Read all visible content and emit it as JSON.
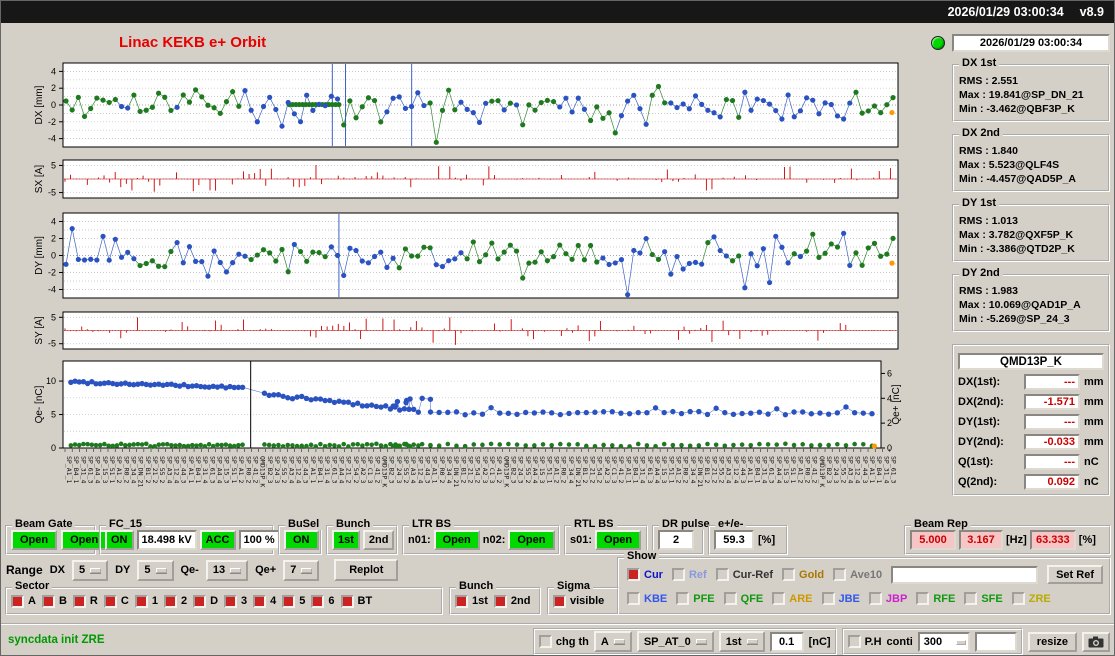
{
  "titlebar": {
    "datetime": "2026/01/29 03:00:34",
    "version": "v8.9"
  },
  "header": {
    "title": "Linac KEKB e+ Orbit",
    "timestamp": "2026/01/29 03:00:34"
  },
  "plots": {
    "dx": {
      "label": "DX [mm]",
      "ticks": [
        "4",
        "2",
        "0",
        "-2",
        "-4"
      ]
    },
    "sx": {
      "label": "SX [A]",
      "ticks": [
        "5",
        "-5"
      ]
    },
    "dy": {
      "label": "DY [mm]",
      "ticks": [
        "4",
        "2",
        "0",
        "-2",
        "-4"
      ]
    },
    "sy": {
      "label": "SY [A]",
      "ticks": [
        "5",
        "-5"
      ]
    },
    "q": {
      "label": "Qe- [nC]",
      "ticks": [
        "10",
        "5",
        "0"
      ],
      "right_label": "Qe+ [nC]",
      "right_ticks": [
        "6",
        "4",
        "2",
        "0"
      ]
    },
    "x_sample_labels": [
      "SP_A1_1",
      "SP_A1_2",
      "SP_A2_3",
      "SP_A3_4",
      "SP_A4_4",
      "SP_B1_2",
      "SP_B2_3",
      "SP_B4_1",
      "SP_R0_2",
      "SP_C1_3",
      "SP_12_4",
      "SP_15_3",
      "SP_21_2",
      "SP_24_3",
      "SP_31_4",
      "SP_34_4",
      "SP_41_2",
      "SP_44_3",
      "SP_51_1",
      "SP_54_2",
      "SP_55_2",
      "SP_61_3",
      "SP_DN_21",
      "QMD13P_K"
    ]
  },
  "chart_data": [
    {
      "type": "scatter",
      "name": "DX orbit",
      "ylabel": "DX [mm]",
      "ylim": [
        -5,
        5
      ],
      "series": [
        {
          "name": "1st bunch",
          "color": "#1f7a1f"
        },
        {
          "name": "2nd bunch",
          "color": "#2a52c0"
        }
      ],
      "summary": "orbit deviation per BPM, mostly within +/-3 mm, RMS 2.551 (1st) / 1.840 (2nd)"
    },
    {
      "type": "bar",
      "name": "SX steering",
      "ylabel": "SX [A]",
      "ylim": [
        -7,
        7
      ],
      "color": "#cc0000",
      "summary": "small bipolar steering currents, larger burst near 30% of axis"
    },
    {
      "type": "scatter",
      "name": "DY orbit",
      "ylabel": "DY [mm]",
      "ylim": [
        -5,
        5
      ],
      "series": [
        {
          "name": "1st bunch",
          "color": "#1f7a1f"
        },
        {
          "name": "2nd bunch",
          "color": "#2a52c0"
        }
      ],
      "summary": "RMS 1.013 (1st) / 1.983 (2nd), larger spread near right end"
    },
    {
      "type": "bar",
      "name": "SY steering",
      "ylabel": "SY [A]",
      "ylim": [
        -7,
        7
      ],
      "color": "#cc0000",
      "summary": "small bipolar steering currents with isolated tall spike near 47%"
    },
    {
      "type": "scatter",
      "name": "Charge",
      "ylabel": "Qe- [nC]",
      "ylim": [
        0,
        13
      ],
      "y2label": "Qe+ [nC]",
      "y2lim": [
        0,
        7
      ],
      "summary": "Qe- (blue) ~9.8 nC falling stepwise to ~5 nC along the linac; Qe+ (green) ~0.2 nC flat; black marker line near 23% of axis; orange marker at right end"
    }
  ],
  "stats": [
    {
      "title": "DX 1st",
      "rms": "RMS : 2.551",
      "max": "Max : 19.841@SP_DN_21",
      "min": "Min : -3.462@QBF3P_K"
    },
    {
      "title": "DX 2nd",
      "rms": "RMS : 1.840",
      "max": "Max : 5.523@QLF4S",
      "min": "Min : -4.457@QAD5P_A"
    },
    {
      "title": "DY 1st",
      "rms": "RMS : 1.013",
      "max": "Max : 3.782@QXF5P_K",
      "min": "Min : -3.386@QTD2P_K"
    },
    {
      "title": "DY 2nd",
      "rms": "RMS : 1.983",
      "max": "Max : 10.069@QAD1P_A",
      "min": "Min : -5.269@SP_24_3"
    }
  ],
  "monitor": {
    "name": "QMD13P_K",
    "rows": [
      {
        "label": "DX(1st):",
        "value": "---",
        "unit": "mm"
      },
      {
        "label": "DX(2nd):",
        "value": "-1.571",
        "unit": "mm"
      },
      {
        "label": "DY(1st):",
        "value": "---",
        "unit": "mm"
      },
      {
        "label": "DY(2nd):",
        "value": "-0.033",
        "unit": "mm"
      },
      {
        "label": "Q(1st):",
        "value": "---",
        "unit": "nC"
      },
      {
        "label": "Q(2nd):",
        "value": "0.092",
        "unit": "nC"
      }
    ]
  },
  "groups": {
    "beam_gate": {
      "label": "Beam Gate",
      "btn1": "Open",
      "btn2": "Open"
    },
    "fc15": {
      "label": "FC_15",
      "on": "ON",
      "kv": "18.498 kV",
      "acc": "ACC",
      "pct": "100 %"
    },
    "busel": {
      "label": "BuSel",
      "on": "ON"
    },
    "bunch": {
      "label": "Bunch",
      "b1": "1st",
      "b2": "2nd"
    },
    "ltr": {
      "label": "LTR BS",
      "n01": "n01:",
      "n01v": "Open",
      "n02": "n02:",
      "n02v": "Open"
    },
    "rtl": {
      "label": "RTL BS",
      "s01": "s01:",
      "s01v": "Open"
    },
    "dr": {
      "label": "DR pulse",
      "value": "2"
    },
    "ratio": {
      "label": "e+/e-",
      "value": "59.3",
      "unit": "[%]"
    },
    "beam_rep": {
      "label": "Beam Rep",
      "v1": "5.000",
      "v2": "3.167",
      "hz": "[Hz]",
      "v3": "63.333",
      "pct": "[%]"
    }
  },
  "range_row": {
    "label": "Range",
    "dx_label": "DX",
    "dx_value": "5",
    "dy_label": "DY",
    "dy_value": "5",
    "qm_label": "Qe-",
    "qm_value": "13",
    "qp_label": "Qe+",
    "qp_value": "7",
    "replot": "Replot"
  },
  "show": {
    "label": "Show",
    "row1": [
      {
        "label": "Cur",
        "color": "#1111cc",
        "checked": true
      },
      {
        "label": "Ref",
        "color": "#8899dd",
        "checked": false
      },
      {
        "label": "Cur-Ref",
        "color": "#333333",
        "checked": false
      },
      {
        "label": "Gold",
        "color": "#aa7700",
        "checked": false
      },
      {
        "label": "Ave10",
        "color": "#777777",
        "checked": false
      }
    ],
    "ref_input": "",
    "set_ref": "Set Ref",
    "row2": [
      {
        "label": "KBE",
        "color": "#3355ee",
        "checked": false
      },
      {
        "label": "PFE",
        "color": "#119911",
        "checked": false
      },
      {
        "label": "QFE",
        "color": "#119911",
        "checked": false
      },
      {
        "label": "ARE",
        "color": "#cc9900",
        "checked": false
      },
      {
        "label": "JBE",
        "color": "#3355ee",
        "checked": false
      },
      {
        "label": "JBP",
        "color": "#cc22cc",
        "checked": false
      },
      {
        "label": "RFE",
        "color": "#119911",
        "checked": false
      },
      {
        "label": "SFE",
        "color": "#119911",
        "checked": false
      },
      {
        "label": "ZRE",
        "color": "#bbaa00",
        "checked": false
      }
    ]
  },
  "sector": {
    "label": "Sector",
    "items": [
      "A",
      "B",
      "R",
      "C",
      "1",
      "2",
      "D",
      "3",
      "4",
      "5",
      "6",
      "BT"
    ]
  },
  "bunch_sel": {
    "label": "Bunch",
    "items": [
      "1st",
      "2nd"
    ]
  },
  "sigma": {
    "label": "Sigma",
    "items": [
      "visible"
    ]
  },
  "statusbar": {
    "message": "syncdata init ZRE",
    "chg_th": "chg th",
    "dd_a": "A",
    "dd_sp": "SP_AT_0",
    "dd_1st": "1st",
    "threshold": "0.1",
    "unit": "[nC]",
    "ph": "P.H",
    "conti": "conti",
    "count": "300",
    "blank": "",
    "resize": "resize"
  },
  "colors": {
    "series_green": "#1f7a1f",
    "series_blue": "#2a52c0",
    "steering_red": "#cc0000",
    "marker_orange": "#ff9900",
    "button_green": "#00d800",
    "value_red": "#cc0000",
    "pink_field": "#f6c6c6",
    "title_red": "#e60000",
    "checked_red": "#cc2222"
  }
}
